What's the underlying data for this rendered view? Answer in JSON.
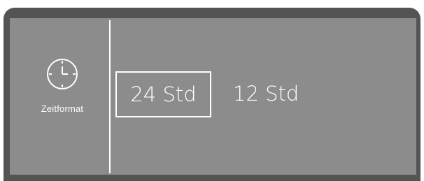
{
  "sidebar": {
    "icon": "clock-icon",
    "label": "Zeitformat"
  },
  "options": [
    {
      "label": "24 Std",
      "selected": true
    },
    {
      "label": "12 Std",
      "selected": false
    }
  ],
  "colors": {
    "bezel": "#545454",
    "screen": "#8c8c8d",
    "foreground": "#ffffff"
  }
}
